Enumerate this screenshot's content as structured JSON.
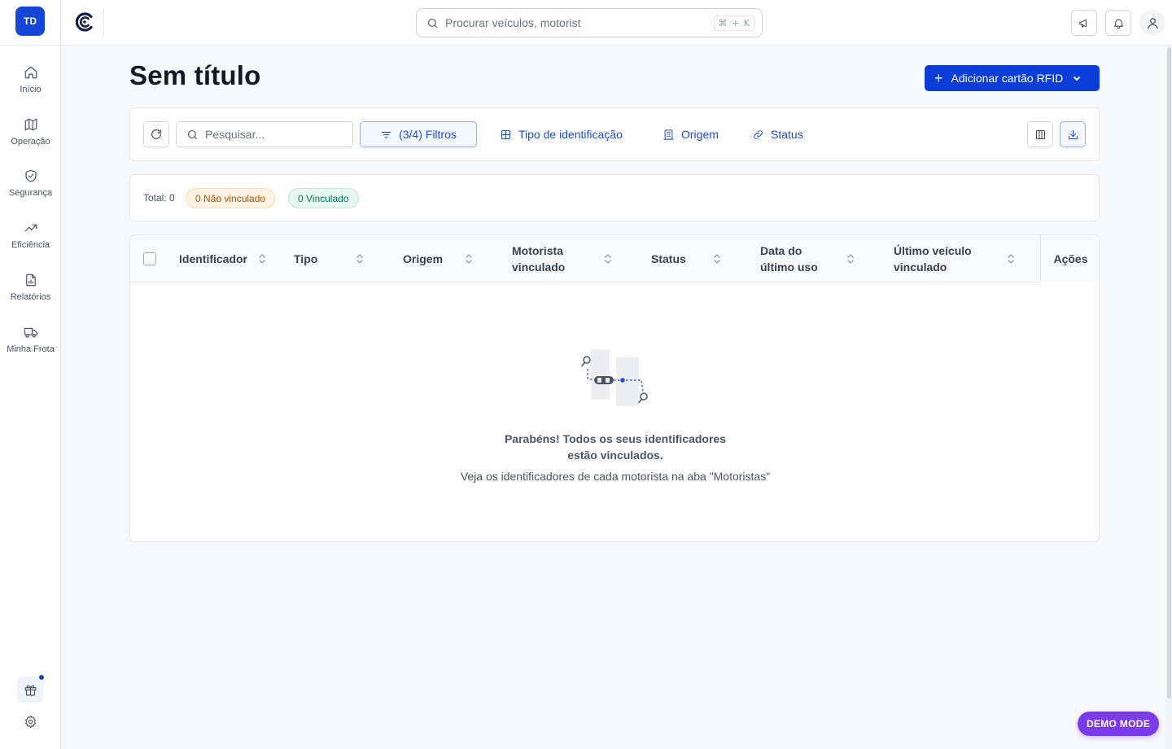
{
  "rail": {
    "avatar": "TD",
    "items": [
      {
        "label": "Início",
        "icon": "home-icon"
      },
      {
        "label": "Operação",
        "icon": "map-icon"
      },
      {
        "label": "Segurança",
        "icon": "shield-icon"
      },
      {
        "label": "Eficiência",
        "icon": "trending-up-icon"
      },
      {
        "label": "Relatórios",
        "icon": "report-icon"
      },
      {
        "label": "Minha Frota",
        "icon": "truck-icon"
      }
    ]
  },
  "topbar": {
    "search_placeholder": "Procurar veículos, motorist",
    "shortcut": "⌘ + K"
  },
  "page": {
    "title": "Sem título",
    "add_button": "Adicionar cartão RFID"
  },
  "toolbar": {
    "search_placeholder": "Pesquisar...",
    "filters_label": "(3/4) Filtros",
    "chips": [
      "Tipo de identificação",
      "Origem",
      "Status"
    ]
  },
  "summary": {
    "total": "Total: 0",
    "unlinked": "0 Não vinculado",
    "linked": "0 Vinculado"
  },
  "table": {
    "columns": [
      {
        "line1": "Identificador",
        "line2": ""
      },
      {
        "line1": "Tipo",
        "line2": ""
      },
      {
        "line1": "Origem",
        "line2": ""
      },
      {
        "line1": "Motorista",
        "line2": "vinculado"
      },
      {
        "line1": "Status",
        "line2": ""
      },
      {
        "line1": "Data do",
        "line2": "último uso"
      },
      {
        "line1": "Último veículo",
        "line2": "vinculado"
      }
    ],
    "actions_header": "Ações"
  },
  "empty_state": {
    "title_line1": "Parabéns! Todos os seus identificadores",
    "title_line2": "estão vinculados.",
    "subtitle": "Veja os identificadores de cada motorista na aba \"Motoristas\""
  },
  "demo_badge": "DEMO MODE",
  "colors": {
    "primary": "#0b3ed8",
    "link": "#1d4ed8",
    "warning_bg": "#fef3e2",
    "success_bg": "#e6f7f1",
    "demo": "#7c3aed"
  }
}
